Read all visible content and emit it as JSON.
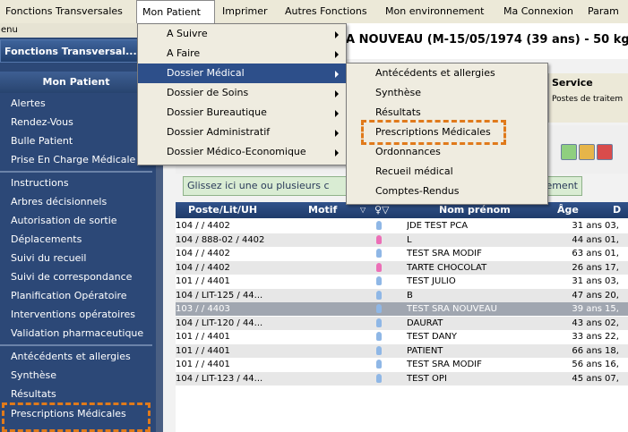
{
  "menubar": {
    "items": [
      "Fonctions Transversales",
      "Mon Patient",
      "Imprimer",
      "Autres Fonctions",
      "Mon environnement",
      "Ma Connexion",
      "Param"
    ]
  },
  "sidebar": {
    "menu_strip": "enu",
    "fonctions_header": "Fonctions Transversal...",
    "mon_patient_header": "Mon Patient",
    "group1": [
      "Alertes",
      "Rendez-Vous",
      "Bulle Patient",
      "Prise En Charge Médicale"
    ],
    "group2": [
      "Instructions",
      "Arbres décisionnels",
      "Autorisation de sortie",
      "Déplacements",
      "Suivi du recueil",
      "Suivi de correspondance",
      "Planification Opératoire",
      "Interventions opératoires",
      "Validation pharmaceutique"
    ],
    "group3": [
      "Antécédents et allergies",
      "Synthèse",
      "Résultats",
      "Prescriptions Médicales"
    ]
  },
  "main": {
    "patient_title": "A NOUVEAU (M-15/05/1974 (39 ans) - 50 kg",
    "service_label": "Service",
    "service_value": "Postes de traitem",
    "drop_zone_text": "Glissez ici une ou plusieurs c",
    "drop_zone_tail": "ement"
  },
  "menu_mon_patient": {
    "items": [
      "A Suivre",
      "A Faire",
      "Dossier Médical",
      "Dossier de Soins",
      "Dossier Bureautique",
      "Dossier Administratif",
      "Dossier Médico-Economique"
    ]
  },
  "menu_dossier_medical": {
    "items": [
      "Antécédents et allergies",
      "Synthèse",
      "Résultats",
      "Prescriptions Médicales",
      "Ordonnances",
      "Recueil médical",
      "Comptes-Rendus"
    ]
  },
  "table": {
    "headers": [
      "Poste/Lit/UH",
      "Motif",
      "Nom prénom",
      "Âge",
      "D"
    ],
    "rows": [
      {
        "poste": "104 /  / 4402",
        "sex": "m",
        "nom": "JDE TEST PCA",
        "age": "31 ans",
        "d": "03,"
      },
      {
        "poste": "104 / 888-02 / 4402",
        "sex": "f",
        "nom": "L",
        "age": "44 ans",
        "d": "01,"
      },
      {
        "poste": "104 /  / 4402",
        "sex": "m",
        "nom": "TEST SRA MODIF",
        "age": "63 ans",
        "d": "01,"
      },
      {
        "poste": "104 /  / 4402",
        "sex": "f",
        "nom": "TARTE CHOCOLAT",
        "age": "26 ans",
        "d": "17,"
      },
      {
        "poste": "101 /  / 4401",
        "sex": "m",
        "nom": "TEST JULIO",
        "age": "31 ans",
        "d": "03,"
      },
      {
        "poste": "104 / LIT-125 / 44...",
        "sex": "m",
        "nom": "B",
        "age": "47 ans",
        "d": "20,"
      },
      {
        "poste": "103 /  / 4403",
        "sex": "m",
        "nom": "TEST SRA NOUVEAU",
        "age": "39 ans",
        "d": "15,"
      },
      {
        "poste": "104 / LIT-120 / 44...",
        "sex": "m",
        "nom": "DAURAT",
        "age": "43 ans",
        "d": "02,"
      },
      {
        "poste": "101 /  / 4401",
        "sex": "m",
        "nom": "TEST DANY",
        "age": "33 ans",
        "d": "22,"
      },
      {
        "poste": "101 /  / 4401",
        "sex": "m",
        "nom": "PATIENT",
        "age": "66 ans",
        "d": "18,"
      },
      {
        "poste": "101 /  / 4401",
        "sex": "m",
        "nom": "TEST SRA MODIF",
        "age": "56 ans",
        "d": "16,"
      },
      {
        "poste": "104 / LIT-123 / 44...",
        "sex": "m",
        "nom": "TEST OPI",
        "age": "45 ans",
        "d": "07,"
      }
    ]
  },
  "colors": {
    "sidebar_bg": "#2c4877",
    "menu_highlight": "#2d4f8a",
    "annotation_dash": "#e07a1b",
    "female": "#ec6fb7",
    "male": "#8fb7e6"
  }
}
